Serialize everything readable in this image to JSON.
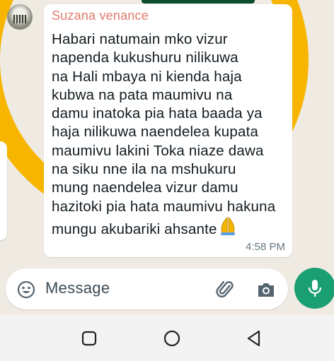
{
  "chat": {
    "sender_name": "Suzana venance",
    "message_text": "Habari natumain mko vizur\nnapenda kukushuru nilikuwa\nna Hali mbaya ni kienda haja\nkubwa na pata maumivu na\ndamu inatoka pia hata baada ya\nhaja nilikuwa naendelea kupata\nmaumivu lakini Toka niaze dawa\nna siku nne ila na mshukuru\nmung naendelea vizur damu\nhazitoki pia hata maumivu hakuna\nmungu akubariki ahsante",
    "emoji_icon": "folded-hands-icon",
    "time": "4:58 PM"
  },
  "composer": {
    "placeholder": "Message",
    "icons": [
      "smiley-icon",
      "paperclip-icon",
      "camera-icon",
      "microphone-icon"
    ]
  },
  "navigation": {
    "icons": [
      "recents-square-icon",
      "home-circle-icon",
      "back-triangle-icon"
    ]
  },
  "colors": {
    "sender": "#e07c6f",
    "accent_green": "#1a9f72",
    "wallpaper_ring": "#f7b500"
  }
}
